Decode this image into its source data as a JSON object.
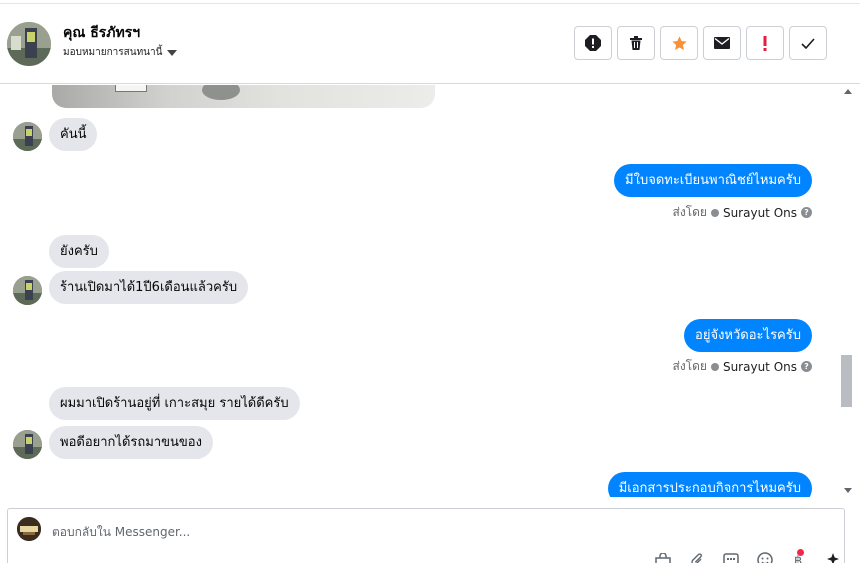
{
  "header": {
    "name": "คุณ ธีรภัทรฯ",
    "assign_label": "มอบหมายการสนทนานี้"
  },
  "actions": [
    {
      "icon": "spam-icon"
    },
    {
      "icon": "trash-icon"
    },
    {
      "icon": "star-icon",
      "color": "#f7923a"
    },
    {
      "icon": "mail-icon"
    },
    {
      "icon": "important-icon",
      "color": "#e41e3f"
    },
    {
      "icon": "check-icon"
    }
  ],
  "messages": {
    "m1": "คันนี้",
    "m2": "มีใบจดทะเบียนพาณิชย์ไหมครับ",
    "m3": "ยังครับ",
    "m4": "ร้านเปิดมาได้1ปี6เดือนแล้วครับ",
    "m5": "อยู่จังหวัดอะไรครับ",
    "m6": "ผมมาเปิดร้านอยู่ที่ เกาะสมุย รายได้ดีครับ",
    "m7": "พอดีอยากได้รถมาขนของ",
    "m8": "มีเอกสารประกอบกิจการไหมครับ"
  },
  "sent_by": {
    "label": "ส่งโดย",
    "sender": "Surayut Ons"
  },
  "composer": {
    "placeholder": "ตอบกลับใน Messenger..."
  },
  "colors": {
    "outgoing": "#0084ff",
    "incoming": "#e4e6eb"
  }
}
